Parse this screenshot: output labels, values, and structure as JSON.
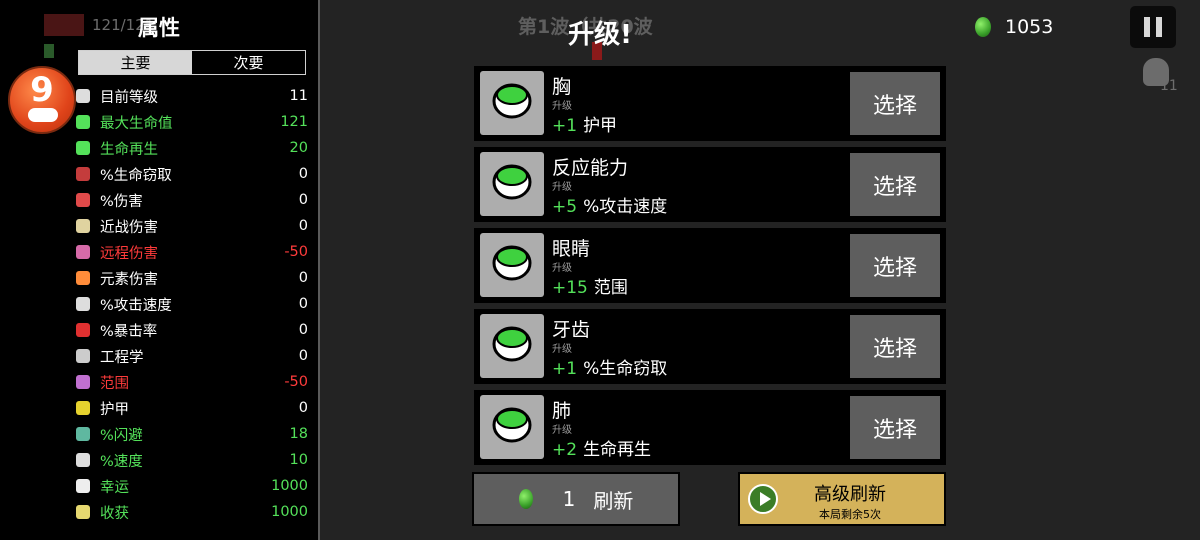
{
  "hud": {
    "hp_text": "121/121",
    "wave_text": "第1波（共20波",
    "materials": "1053",
    "bag_count": "11"
  },
  "stats": {
    "title": "属性",
    "tabs": [
      "主要",
      "次要"
    ],
    "active_tab": "主要",
    "level": "9",
    "rows": [
      {
        "label": "目前等级",
        "value": "11",
        "color": "#ffffff",
        "icon_color": "#dddddd"
      },
      {
        "label": "最大生命值",
        "value": "121",
        "color": "#54e15a",
        "icon_color": "#54e15a"
      },
      {
        "label": "生命再生",
        "value": "20",
        "color": "#54e15a",
        "icon_color": "#54e15a"
      },
      {
        "label": "%生命窃取",
        "value": "0",
        "color": "#ffffff",
        "icon_color": "#c43c3c"
      },
      {
        "label": "%伤害",
        "value": "0",
        "color": "#ffffff",
        "icon_color": "#e04a4a"
      },
      {
        "label": "近战伤害",
        "value": "0",
        "color": "#ffffff",
        "icon_color": "#e0d3a0"
      },
      {
        "label": "远程伤害",
        "value": "-50",
        "color": "#ff3b3b",
        "icon_color": "#d66aa8"
      },
      {
        "label": "元素伤害",
        "value": "0",
        "color": "#ffffff",
        "icon_color": "#ff8c3a"
      },
      {
        "label": "%攻击速度",
        "value": "0",
        "color": "#ffffff",
        "icon_color": "#dddddd"
      },
      {
        "label": "%暴击率",
        "value": "0",
        "color": "#ffffff",
        "icon_color": "#e03030"
      },
      {
        "label": "工程学",
        "value": "0",
        "color": "#ffffff",
        "icon_color": "#cccccc"
      },
      {
        "label": "范围",
        "value": "-50",
        "color": "#ff3b3b",
        "icon_color": "#c070d0"
      },
      {
        "label": "护甲",
        "value": "0",
        "color": "#ffffff",
        "icon_color": "#e6d22e"
      },
      {
        "label": "%闪避",
        "value": "18",
        "color": "#54e15a",
        "icon_color": "#5fb8a0"
      },
      {
        "label": "%速度",
        "value": "10",
        "color": "#54e15a",
        "icon_color": "#dddddd"
      },
      {
        "label": "幸运",
        "value": "1000",
        "color": "#54e15a",
        "icon_color": "#eeeeee"
      },
      {
        "label": "收获",
        "value": "1000",
        "color": "#54e15a",
        "icon_color": "#e6d870"
      }
    ]
  },
  "upgrade": {
    "title": "升级!",
    "select_label": "选择",
    "cards": [
      {
        "name": "胸",
        "sub": "升级",
        "plus": "+1",
        "effect": "护甲",
        "icon": "chest-armor-icon"
      },
      {
        "name": "反应能力",
        "sub": "升级",
        "plus": "+5",
        "effect": "%攻击速度",
        "icon": "reflex-icon"
      },
      {
        "name": "眼睛",
        "sub": "升级",
        "plus": "+15",
        "effect": "范围",
        "icon": "eyes-icon"
      },
      {
        "name": "牙齿",
        "sub": "升级",
        "plus": "+1",
        "effect": "%生命窃取",
        "icon": "teeth-icon"
      },
      {
        "name": "肺",
        "sub": "升级",
        "plus": "+2",
        "effect": "生命再生",
        "icon": "lungs-icon"
      }
    ],
    "reroll": {
      "cost": "1",
      "label": "刷新"
    },
    "premium": {
      "label": "高级刷新",
      "sub": "本局剩余5次"
    }
  }
}
